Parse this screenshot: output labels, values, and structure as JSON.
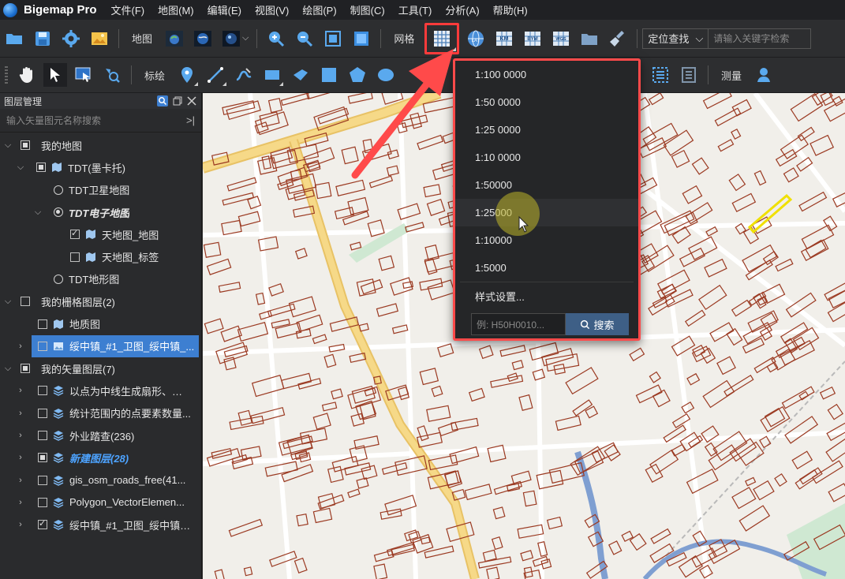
{
  "app": {
    "title": "Bigemap Pro"
  },
  "menu": [
    {
      "label": "文件(F)"
    },
    {
      "label": "地图(M)"
    },
    {
      "label": "编辑(E)"
    },
    {
      "label": "视图(V)"
    },
    {
      "label": "绘图(P)"
    },
    {
      "label": "制图(C)"
    },
    {
      "label": "工具(T)"
    },
    {
      "label": "分析(A)"
    },
    {
      "label": "帮助(H)"
    }
  ],
  "toolbar1": {
    "map_label": "地图",
    "grid_label": "网格",
    "locate_label": "定位查找",
    "search_placeholder": "请输入关键字检索",
    "grid_icon_text_1": "LAT",
    "grid_icon_text_2": "KM",
    "grid_icon_text_3": "BYM",
    "grid_icon_text_4": "WGS"
  },
  "toolbar2": {
    "draw_label": "标绘",
    "measure_label": "测量"
  },
  "panel": {
    "title": "图层管理",
    "search_placeholder": "输入矢量图元名称搜索",
    "search_end": ">|",
    "rows": [
      {
        "label": "我的地图"
      },
      {
        "label": "TDT(墨卡托)"
      },
      {
        "label": "TDT卫星地图"
      },
      {
        "label": "TDT电子地图"
      },
      {
        "label": "天地图_地图"
      },
      {
        "label": "天地图_标签"
      },
      {
        "label": "TDT地形图"
      },
      {
        "label": "我的栅格图层(2)"
      },
      {
        "label": "地质图"
      },
      {
        "label": "绥中镇_#1_卫图_绥中镇_..."
      },
      {
        "label": "我的矢量图层(7)"
      },
      {
        "label": "以点为中线生成扇形、圆..."
      },
      {
        "label": "统计范围内的点要素数量..."
      },
      {
        "label": "外业踏查(236)"
      },
      {
        "label": "新建图层(28)"
      },
      {
        "label": "gis_osm_roads_free(41..."
      },
      {
        "label": "Polygon_VectorElemen..."
      },
      {
        "label": "绥中镇_#1_卫图_绥中镇_..."
      }
    ]
  },
  "dropdown": {
    "items": [
      {
        "label": "1:100 0000"
      },
      {
        "label": "1:50 0000"
      },
      {
        "label": "1:25 0000"
      },
      {
        "label": "1:10 0000"
      },
      {
        "label": "1:50000"
      },
      {
        "label": "1:25000"
      },
      {
        "label": "1:10000"
      },
      {
        "label": "1:5000"
      }
    ],
    "style_settings": "样式设置...",
    "search_placeholder": "例: H50H0010...",
    "search_button": "搜索"
  },
  "colors": {
    "accent_red": "#ff4a4a",
    "selected_row": "#3d7fd1",
    "active_layer_text": "#4da3ff",
    "building_outline": "#9b3a22",
    "main_road": "#f3d27c"
  }
}
